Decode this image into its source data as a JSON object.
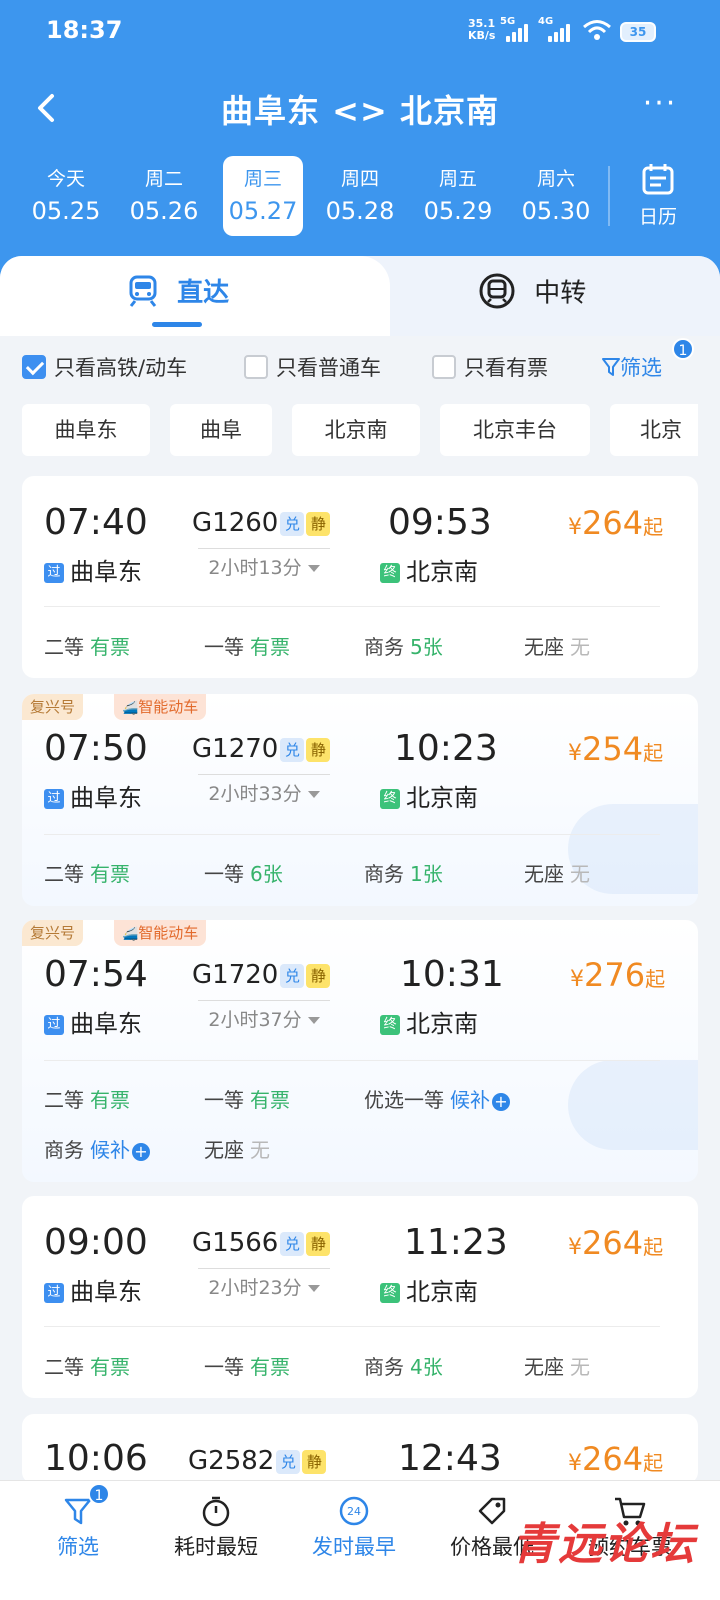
{
  "status_bar": {
    "time": "18:37",
    "net_speed_value": "35.1",
    "net_speed_unit": "KB/s",
    "sim1": "5G",
    "sim2": "4G",
    "battery": "35"
  },
  "header": {
    "title": "曲阜东 <> 北京南",
    "more_label": "···"
  },
  "dates": [
    {
      "weekday": "今天",
      "date": "05.25",
      "active": false
    },
    {
      "weekday": "周二",
      "date": "05.26",
      "active": false
    },
    {
      "weekday": "周三",
      "date": "05.27",
      "active": true
    },
    {
      "weekday": "周四",
      "date": "05.28",
      "active": false
    },
    {
      "weekday": "周五",
      "date": "05.29",
      "active": false
    },
    {
      "weekday": "周六",
      "date": "05.30",
      "active": false
    }
  ],
  "calendar_label": "日历",
  "tabs": {
    "direct": "直达",
    "transfer": "中转"
  },
  "filters": {
    "high_speed_only": {
      "label": "只看高铁/动车",
      "checked": true
    },
    "normal_only": {
      "label": "只看普通车",
      "checked": false
    },
    "available_only": {
      "label": "只看有票",
      "checked": false
    },
    "filter_button": "筛选",
    "filter_count": "1"
  },
  "stations": [
    "曲阜东",
    "曲阜",
    "北京南",
    "北京丰台",
    "北京"
  ],
  "trains": [
    {
      "tags": [],
      "dep_time": "07:40",
      "train_no": "G1260",
      "badge_dui": "兑",
      "badge_jing": "静",
      "arr_time": "09:53",
      "duration": "2小时13分",
      "dep_icon": "过",
      "dep_station": "曲阜东",
      "arr_icon": "终",
      "arr_station": "北京南",
      "price_currency": "¥",
      "price": "264",
      "price_suffix": "起",
      "seats": [
        {
          "cls": "二等",
          "status": "有票"
        },
        {
          "cls": "一等",
          "status": "有票"
        },
        {
          "cls": "商务",
          "status": "5张"
        },
        {
          "cls": "无座",
          "status": "无"
        }
      ]
    },
    {
      "tags": [
        "复兴号",
        "智能动车"
      ],
      "dep_time": "07:50",
      "train_no": "G1270",
      "badge_dui": "兑",
      "badge_jing": "静",
      "arr_time": "10:23",
      "duration": "2小时33分",
      "dep_icon": "过",
      "dep_station": "曲阜东",
      "arr_icon": "终",
      "arr_station": "北京南",
      "price_currency": "¥",
      "price": "254",
      "price_suffix": "起",
      "seats": [
        {
          "cls": "二等",
          "status": "有票"
        },
        {
          "cls": "一等",
          "status": "6张"
        },
        {
          "cls": "商务",
          "status": "1张"
        },
        {
          "cls": "无座",
          "status": "无"
        }
      ]
    },
    {
      "tags": [
        "复兴号",
        "智能动车"
      ],
      "dep_time": "07:54",
      "train_no": "G1720",
      "badge_dui": "兑",
      "badge_jing": "静",
      "arr_time": "10:31",
      "duration": "2小时37分",
      "dep_icon": "过",
      "dep_station": "曲阜东",
      "arr_icon": "终",
      "arr_station": "北京南",
      "price_currency": "¥",
      "price": "276",
      "price_suffix": "起",
      "seats": [
        {
          "cls": "二等",
          "status": "有票"
        },
        {
          "cls": "一等",
          "status": "有票"
        },
        {
          "cls": "优选一等",
          "status": "候补"
        },
        {
          "cls": "商务",
          "status": "候补"
        },
        {
          "cls": "无座",
          "status": "无"
        }
      ]
    },
    {
      "tags": [],
      "dep_time": "09:00",
      "train_no": "G1566",
      "badge_dui": "兑",
      "badge_jing": "静",
      "arr_time": "11:23",
      "duration": "2小时23分",
      "dep_icon": "过",
      "dep_station": "曲阜东",
      "arr_icon": "终",
      "arr_station": "北京南",
      "price_currency": "¥",
      "price": "264",
      "price_suffix": "起",
      "seats": [
        {
          "cls": "二等",
          "status": "有票"
        },
        {
          "cls": "一等",
          "status": "有票"
        },
        {
          "cls": "商务",
          "status": "4张"
        },
        {
          "cls": "无座",
          "status": "无"
        }
      ]
    },
    {
      "tags": [],
      "dep_time": "10:06",
      "train_no": "G2582",
      "badge_dui": "兑",
      "badge_jing": "静",
      "arr_time": "12:43",
      "price_currency": "¥",
      "price": "264",
      "price_suffix": "起"
    }
  ],
  "bottom_bar": {
    "filter": "筛选",
    "filter_count": "1",
    "shortest": "耗时最短",
    "earliest": "发时最早",
    "earliest_icon_text": "24",
    "cheapest": "价格最低",
    "last": "预约车票"
  },
  "watermark": "青远论坛",
  "colors": {
    "primary": "#3d96ee",
    "accent_blue": "#2e86e8",
    "price_orange": "#f08a22",
    "available_green": "#36b36b",
    "none_grey": "#b8b8b8"
  }
}
